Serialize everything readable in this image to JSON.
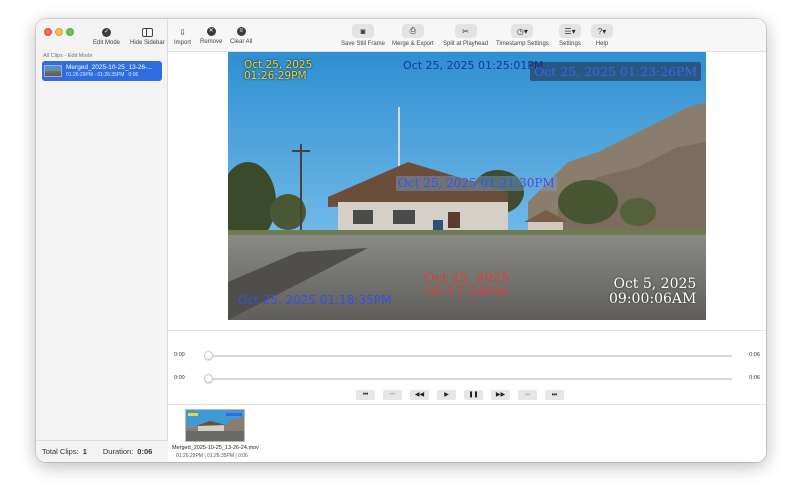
{
  "sidebar": {
    "edit_mode_label": "Edit Mode",
    "hide_sidebar_label": "Hide Sidebar",
    "section_label": "All Clips - Edit Mode",
    "clip": {
      "name": "Merged_2025-10-25_13-26-...",
      "times": "01:26:29PM - 01:26:35PM",
      "duration": "0:06"
    },
    "footer": {
      "total_clips_label": "Total Clips:",
      "total_clips_value": "1",
      "duration_label": "Duration:",
      "duration_value": "0:06"
    }
  },
  "toolbar": {
    "import_label": "Import",
    "remove_label": "Remove",
    "clear_all_label": "Clear All",
    "save_still_label": "Save Still Frame",
    "merge_export_label": "Merge & Export",
    "split_label": "Split at Playhead",
    "timestamp_settings_label": "Timestamp Settings",
    "settings_label": "Settings",
    "help_label": "Help"
  },
  "video": {
    "overlay_yellow": [
      "Oct 25, 2025",
      "01:26:29PM"
    ],
    "overlay_top_center": "Oct 25, 2025  01:25:01PM",
    "overlay_top_right": "Oct 25, 2025  01:23:26PM",
    "overlay_center": "Oct 25, 2025  01:21:30PM",
    "overlay_bottom_left": "Oct 25, 2025  01:18:35PM",
    "overlay_red": [
      "Oct 25, 2025",
      "01:17:14PM"
    ],
    "overlay_white": [
      "Oct 5, 2025",
      "09:00:06AM"
    ]
  },
  "playback": {
    "slider1": {
      "start": "0:00",
      "end": "0:06",
      "position": 0
    },
    "slider2": {
      "start": "0:00",
      "end": "0:06",
      "position": 0
    }
  },
  "timeline": {
    "clip_name": "Merged_2025-10-25_13-26-24.mov",
    "clip_times": "01:26:29PM | 01:26:35PM | 0:06"
  },
  "colors": {
    "selection": "#2f6de0",
    "overlay_yellow": "#f3d23a",
    "overlay_blue": "#1b3ed6",
    "overlay_red": "#e03a3a"
  }
}
